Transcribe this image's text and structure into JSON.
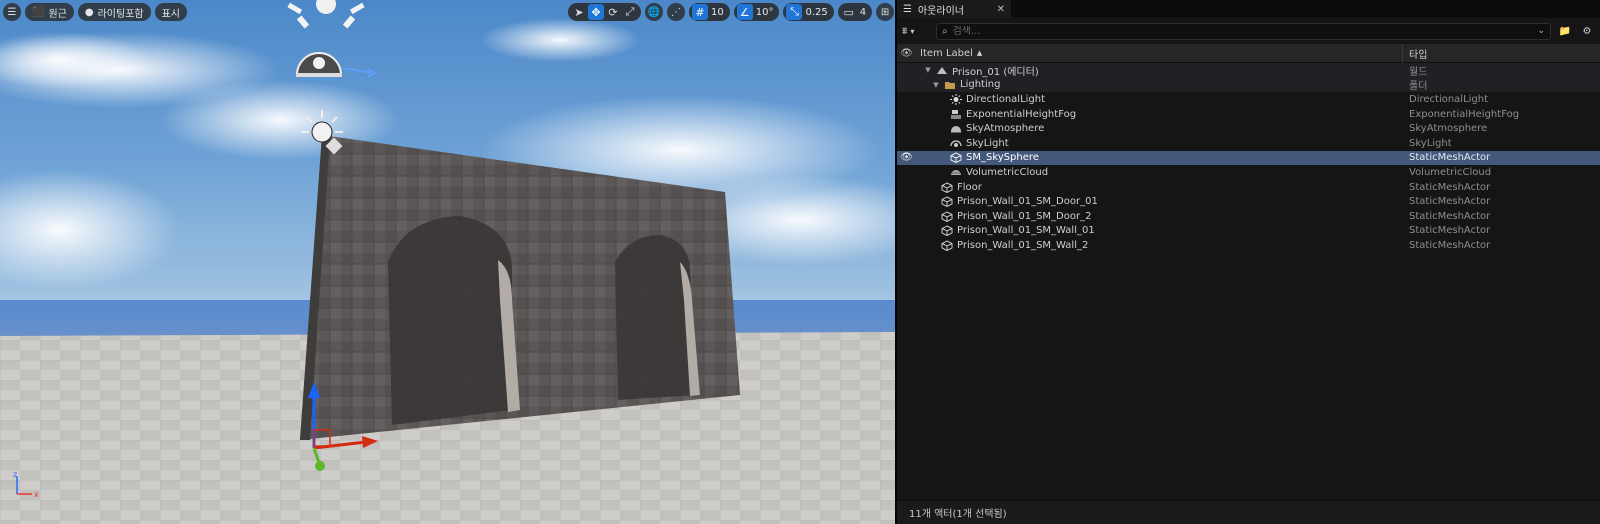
{
  "viewport": {
    "toolbar": {
      "perspective_label": "원근",
      "lighting_label": "라이팅포함",
      "show_label": "표시",
      "grid_snap_value": "10",
      "rotation_snap_value": "10°",
      "scale_snap_value": "0.25",
      "camera_speed_value": "4"
    },
    "axis_labels": {
      "x": "x",
      "z": "z"
    }
  },
  "outliner": {
    "tab_title": "아웃라이너",
    "search_placeholder": "검색...",
    "columns": {
      "label": "Item Label",
      "type": "타입"
    },
    "rows": [
      {
        "label": "Prison_01 (에디터)",
        "type": "월드",
        "icon": "world-icon",
        "kind": "world"
      },
      {
        "label": "Lighting",
        "type": "폴더",
        "icon": "folder-icon",
        "kind": "folder"
      },
      {
        "label": "DirectionalLight",
        "type": "DirectionalLight",
        "icon": "directional-light-icon",
        "kind": "child"
      },
      {
        "label": "ExponentialHeightFog",
        "type": "ExponentialHeightFog",
        "icon": "fog-icon",
        "kind": "child"
      },
      {
        "label": "SkyAtmosphere",
        "type": "SkyAtmosphere",
        "icon": "sky-atmosphere-icon",
        "kind": "child"
      },
      {
        "label": "SkyLight",
        "type": "SkyLight",
        "icon": "sky-light-icon",
        "kind": "child"
      },
      {
        "label": "SM_SkySphere",
        "type": "StaticMeshActor",
        "icon": "static-mesh-icon",
        "kind": "child",
        "selected": true
      },
      {
        "label": "VolumetricCloud",
        "type": "VolumetricCloud",
        "icon": "cloud-icon",
        "kind": "child"
      },
      {
        "label": "Floor",
        "type": "StaticMeshActor",
        "icon": "static-mesh-icon",
        "kind": "top"
      },
      {
        "label": "Prison_Wall_01_SM_Door_01",
        "type": "StaticMeshActor",
        "icon": "static-mesh-icon",
        "kind": "top"
      },
      {
        "label": "Prison_Wall_01_SM_Door_2",
        "type": "StaticMeshActor",
        "icon": "static-mesh-icon",
        "kind": "top"
      },
      {
        "label": "Prison_Wall_01_SM_Wall_01",
        "type": "StaticMeshActor",
        "icon": "static-mesh-icon",
        "kind": "top"
      },
      {
        "label": "Prison_Wall_01_SM_Wall_2",
        "type": "StaticMeshActor",
        "icon": "static-mesh-icon",
        "kind": "top"
      }
    ],
    "status": "11개 액터(1개 선택됨)"
  },
  "colors": {
    "accent": "#1f76d6",
    "selection": "#43587a"
  }
}
